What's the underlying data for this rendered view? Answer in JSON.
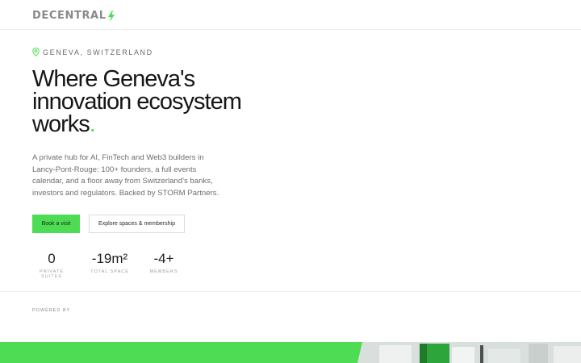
{
  "brand": {
    "logo_text": "DECENTRAL",
    "accent": "#4fdc55"
  },
  "location": {
    "icon": "map-pin-icon",
    "text": "GENEVA, SWITZERLAND"
  },
  "hero": {
    "line1": "Where Geneva's",
    "line2": "innovation ecosystem",
    "line3": "works",
    "line3_end": ".",
    "description": "A private hub for AI, FinTech and Web3 builders in Lancy-Pont-Rouge: 100+ founders, a full events calendar, and a floor away from Switzerland's banks, investors and regulators. Backed by STORM Partners."
  },
  "buttons": {
    "primary": "Book a visit",
    "secondary": "Explore spaces & membership"
  },
  "stats": [
    {
      "value": "0",
      "label": "PRIVATE SUITES"
    },
    {
      "value": "-19m²",
      "label": "TOTAL SPACE"
    },
    {
      "value": "-4+",
      "label": "MEMBERS"
    }
  ],
  "powered_by": "POWERED BY"
}
